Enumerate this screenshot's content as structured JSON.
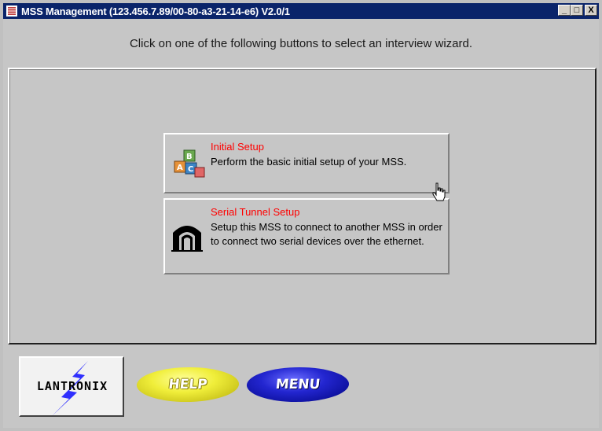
{
  "window": {
    "title": "MSS Management (123.456.7.89/00-80-a3-21-14-e6) V2.0/1",
    "controls": {
      "minimize": "_",
      "maximize": "□",
      "close": "X"
    }
  },
  "instruction": "Click on one of the following buttons to select an interview wizard.",
  "wizards": [
    {
      "title": "Initial Setup",
      "description": "Perform the basic initial setup of your MSS.",
      "icon": "blocks-icon"
    },
    {
      "title": "Serial Tunnel Setup",
      "description": "Setup this MSS to connect to another MSS in order to connect two serial devices over the ethernet.",
      "icon": "tunnel-icon"
    }
  ],
  "footer": {
    "logo_text": "LANTRONIX",
    "help_label": "HELP",
    "menu_label": "MENU"
  },
  "colors": {
    "titlebar": "#0a246a",
    "wizard_title": "#ff0000",
    "help": "#f0ee3a",
    "menu": "#2326d0"
  }
}
